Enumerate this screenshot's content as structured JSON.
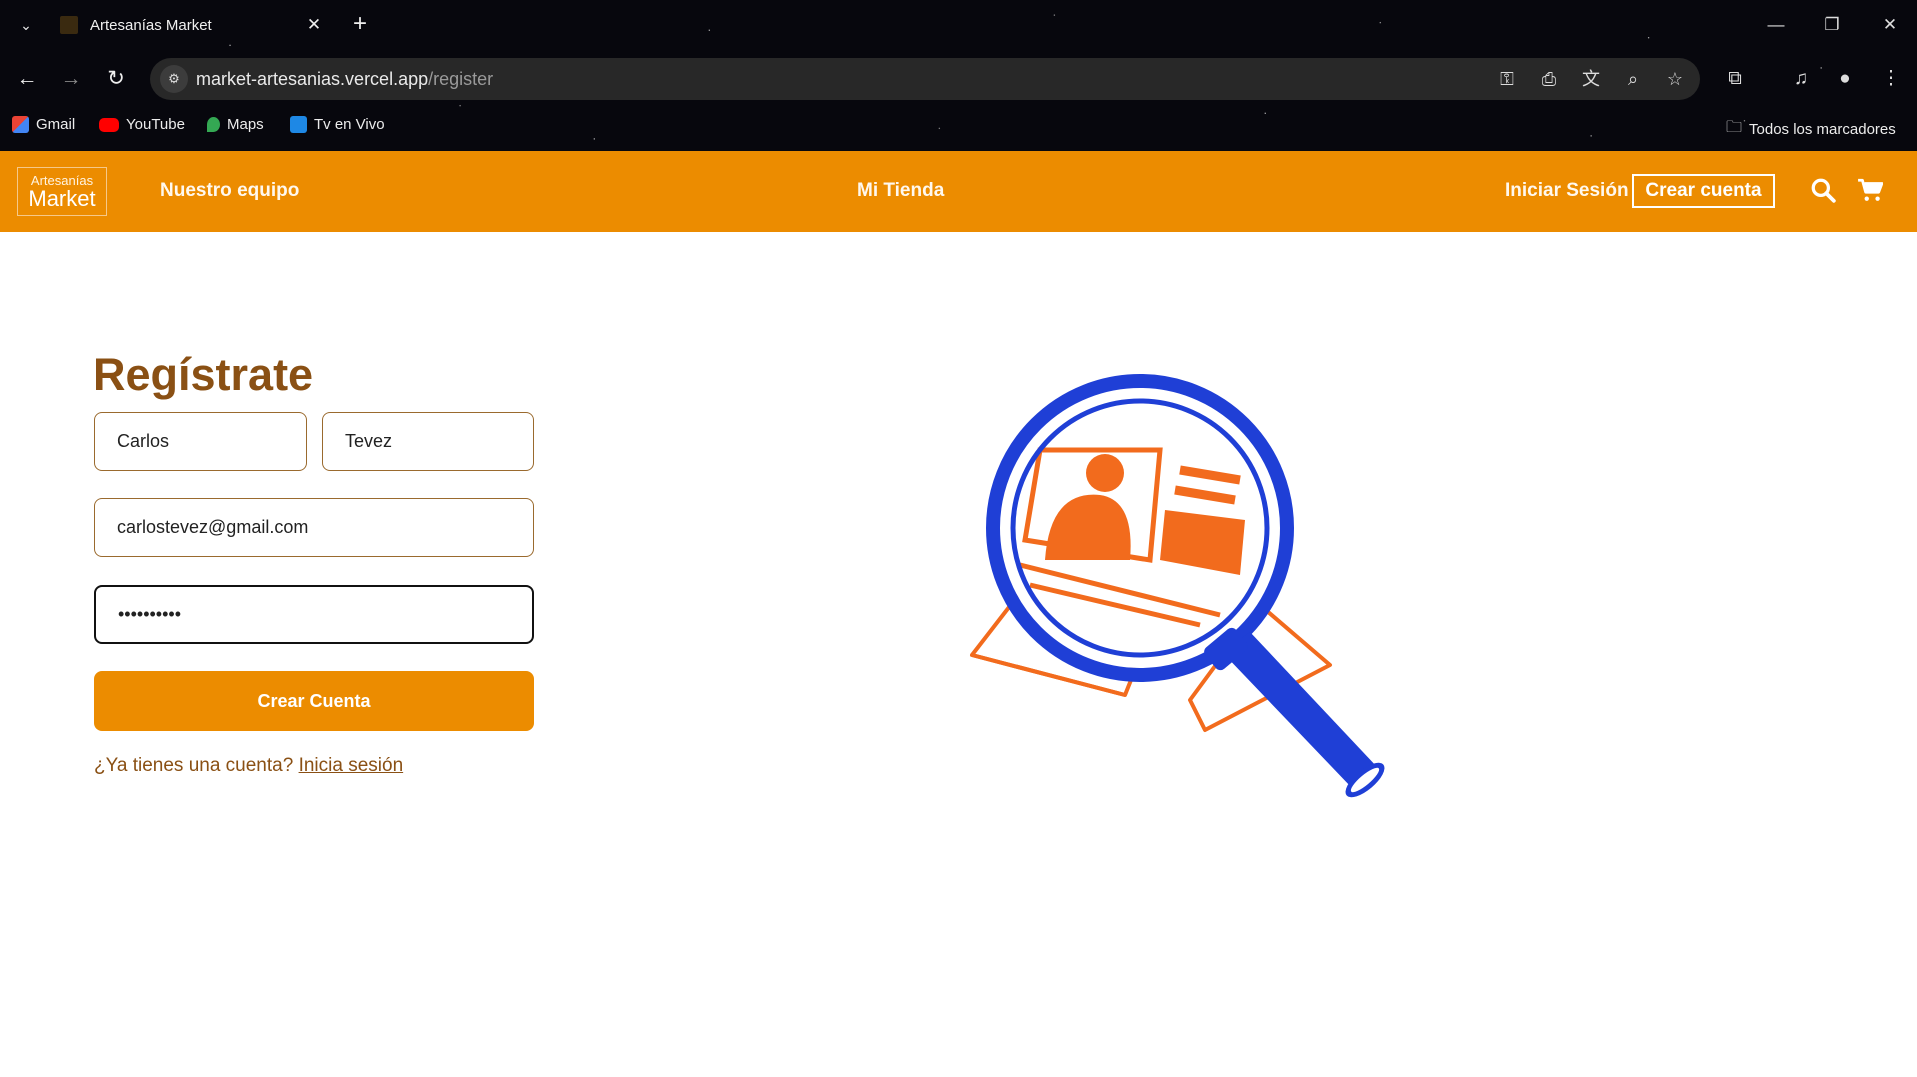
{
  "browser": {
    "tab_title": "Artesanías Market",
    "url_host": "market-artesanias.vercel.app",
    "url_path": "/register",
    "bookmarks": [
      {
        "label": "Gmail",
        "icon": "gmail-icon"
      },
      {
        "label": "YouTube",
        "icon": "youtube-icon"
      },
      {
        "label": "Maps",
        "icon": "maps-icon"
      },
      {
        "label": "Tv en Vivo",
        "icon": "tv-icon"
      }
    ],
    "all_bookmarks_label": "Todos los marcadores"
  },
  "site": {
    "logo_line1": "Artesanías",
    "logo_line2": "Market",
    "nav": {
      "team": "Nuestro equipo",
      "store": "Mi Tienda",
      "login": "Iniciar Sesión",
      "register": "Crear cuenta"
    },
    "brand_color": "#ec8c00"
  },
  "form": {
    "title": "Regístrate",
    "first_name": "Carlos",
    "last_name": "Tevez",
    "email": "carlostevez@gmail.com",
    "password": "••••••••••",
    "submit_label": "Crear Cuenta",
    "login_prompt": "¿Ya tienes una cuenta?",
    "login_link": "Inicia sesión"
  }
}
